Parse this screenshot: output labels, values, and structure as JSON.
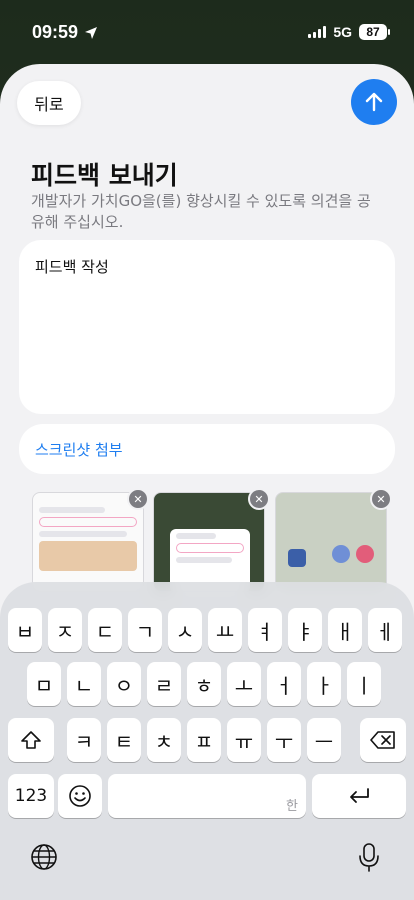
{
  "status": {
    "time": "09:59",
    "network": "5G",
    "battery": "87"
  },
  "header": {
    "back_label": "뒤로",
    "title": "피드백 보내기",
    "subtitle": "개발자가 가치GO을(를) 향상시킬 수 있도록 의견을 공유해 주십시오."
  },
  "form": {
    "feedback_placeholder": "피드백 작성",
    "attach_label": "스크린샷 첨부"
  },
  "keyboard": {
    "row1": [
      "ㅂ",
      "ㅈ",
      "ㄷ",
      "ㄱ",
      "ㅅ",
      "ㅛ",
      "ㅕ",
      "ㅑ",
      "ㅐ",
      "ㅔ"
    ],
    "row2": [
      "ㅁ",
      "ㄴ",
      "ㅇ",
      "ㄹ",
      "ㅎ",
      "ㅗ",
      "ㅓ",
      "ㅏ",
      "ㅣ"
    ],
    "row3": [
      "ㅋ",
      "ㅌ",
      "ㅊ",
      "ㅍ",
      "ㅠ",
      "ㅜ",
      "ㅡ"
    ],
    "numbers_label": "123",
    "space_hint": "한"
  },
  "icons": {
    "location": "location-arrow-icon",
    "send": "arrow-up-icon",
    "remove": "close-icon",
    "shift": "shift-icon",
    "delete": "backspace-icon",
    "emoji": "emoji-icon",
    "return": "return-icon",
    "globe": "globe-icon",
    "mic": "microphone-icon"
  },
  "colors": {
    "accent": "#1f7ef0",
    "sheet": "#f2f2f4"
  }
}
